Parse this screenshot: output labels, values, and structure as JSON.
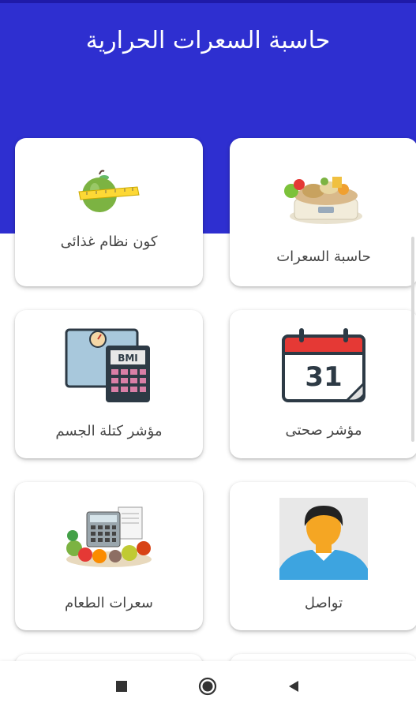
{
  "app": {
    "title": "حاسبة السعرات الحرارية",
    "header_color": "#2e2fd0"
  },
  "cards": [
    {
      "id": "calorie-calculator",
      "label": "حاسبة السعرات",
      "icon": "food-scale-icon"
    },
    {
      "id": "build-diet",
      "label": "كون نظام غذائى",
      "icon": "apple-measuring-tape-icon"
    },
    {
      "id": "health-indicator",
      "label": "مؤشر صحتى",
      "icon": "calendar-31-icon",
      "calendar_day": "31"
    },
    {
      "id": "bmi",
      "label": "مؤشر كتلة الجسم",
      "icon": "bmi-calculator-icon",
      "bmi_text": "BMI"
    },
    {
      "id": "contact",
      "label": "تواصل",
      "icon": "user-avatar-icon"
    },
    {
      "id": "food-calories",
      "label": "سعرات الطعام",
      "icon": "food-calculator-icon"
    }
  ],
  "navigation": {
    "recents": "recents-square-icon",
    "home": "home-circle-icon",
    "back": "back-triangle-icon"
  }
}
